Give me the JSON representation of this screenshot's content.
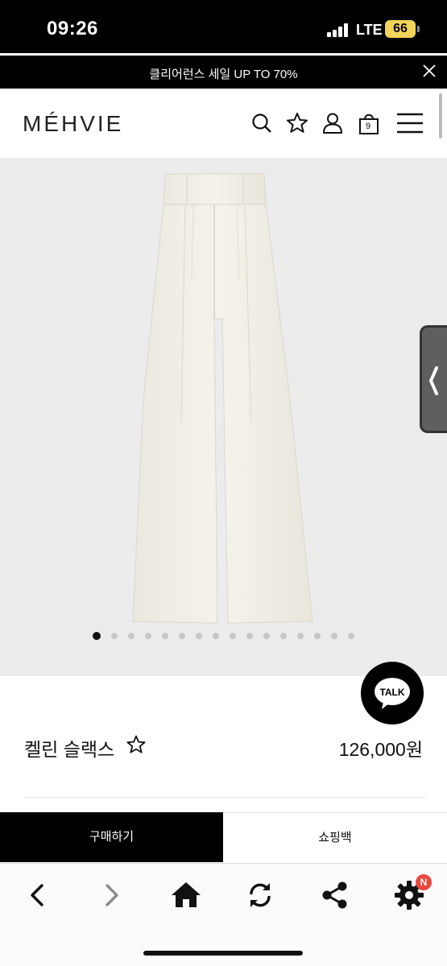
{
  "status": {
    "time": "09:26",
    "network": "LTE",
    "battery": "66"
  },
  "promo": {
    "text": "클리어런스 세일 UP TO 70%"
  },
  "header": {
    "logo": "MÉHVIE",
    "cart_count": "9"
  },
  "icons": {
    "search": "search-icon",
    "wishlist": "star-icon",
    "account": "user-icon",
    "cart": "shopping-bag-icon",
    "menu": "hamburger-menu-icon",
    "close": "close-icon"
  },
  "gallery": {
    "total_dots": 16,
    "active_dot": 1
  },
  "talk": {
    "label": "TALK"
  },
  "product": {
    "name": "켈린 슬랙스",
    "price": "126,000원"
  },
  "actions": {
    "buy_label": "구매하기",
    "bag_label": "쇼핑백"
  },
  "browser": {
    "settings_badge": "N"
  },
  "colors": {
    "background": "#ffffff",
    "accent": "#000000",
    "image_bg": "#ececec",
    "product": "#f1efe6",
    "badge": "#e8473d"
  }
}
